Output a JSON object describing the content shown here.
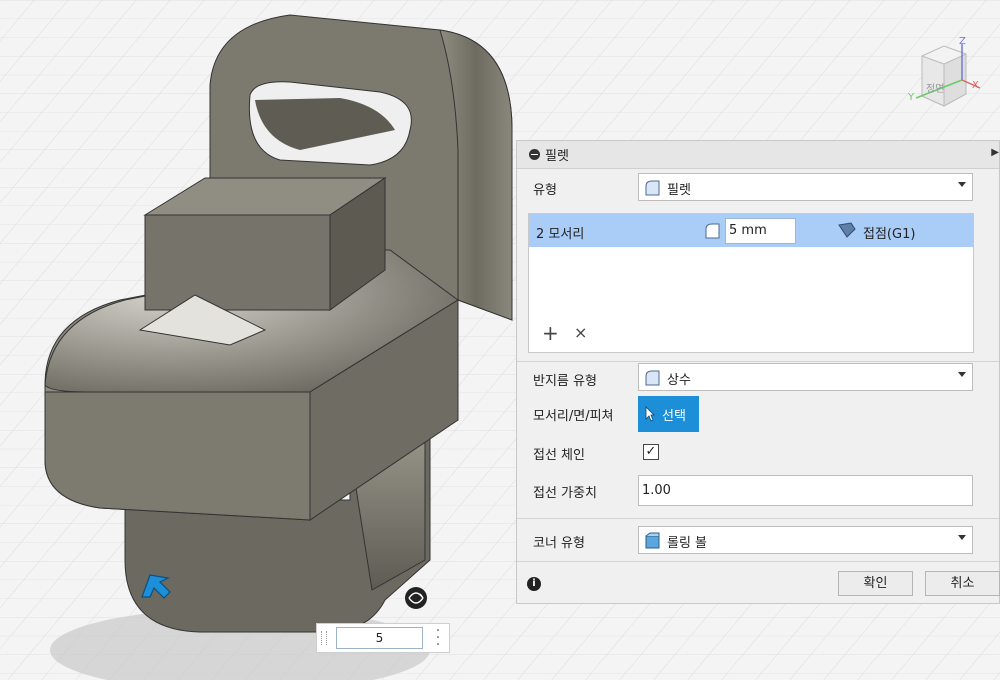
{
  "panel": {
    "title": "필렛",
    "type_label": "유형",
    "type_value": "필렛",
    "edges": {
      "count_label": "2 모서리",
      "radius_value": "5 mm",
      "continuity_value": "접점(G1)",
      "add_symbol": "+",
      "remove_symbol": "×"
    },
    "radius_type_label": "반지름 유형",
    "radius_type_value": "상수",
    "edge_face_feature_label": "모서리/면/피쳐",
    "select_button_label": "선택",
    "tangent_chain_label": "접선 체인",
    "tangent_chain_checked": true,
    "tangent_weight_label": "접선 가중치",
    "tangent_weight_value": "1.00",
    "corner_type_label": "코너 유형",
    "corner_type_value": "롤링 볼",
    "ok_label": "확인",
    "cancel_label": "취소",
    "info_icon": "info-icon"
  },
  "viewport": {
    "value_input": "5",
    "viewcube_face": "정면",
    "axis_labels": {
      "x": "X",
      "y": "Y",
      "z": "Z"
    }
  },
  "colors": {
    "accent": "#1c8fd8",
    "selection_row": "#a9cdf6",
    "model": "#7d7a6f"
  }
}
